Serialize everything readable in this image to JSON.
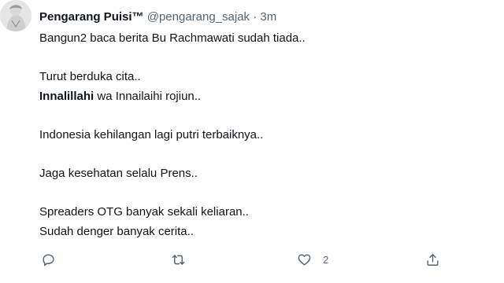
{
  "tweet": {
    "author": {
      "display_name": "Pengarang Puisi™",
      "handle": "@pengarang_sajak",
      "separator": "·",
      "time": "3m"
    },
    "lines": {
      "l1": "Bangun2 baca berita Bu Rachmawati sudah tiada..",
      "l2": "Turut berduka cita..",
      "l3_bold": "Innalillahi",
      "l3_rest": " wa Innailaihi rojiun..",
      "l4": "Indonesia kehilangan lagi putri terbaiknya..",
      "l5": "Jaga kesehatan selalu Prens..",
      "l6": "Spreaders OTG banyak sekali keliaran..",
      "l7": "Sudah denger banyak cerita.."
    },
    "actions": {
      "reply_icon": "reply-icon",
      "retweet_icon": "retweet-icon",
      "like_icon": "heart-icon",
      "like_count": "2",
      "share_icon": "share-icon"
    }
  }
}
